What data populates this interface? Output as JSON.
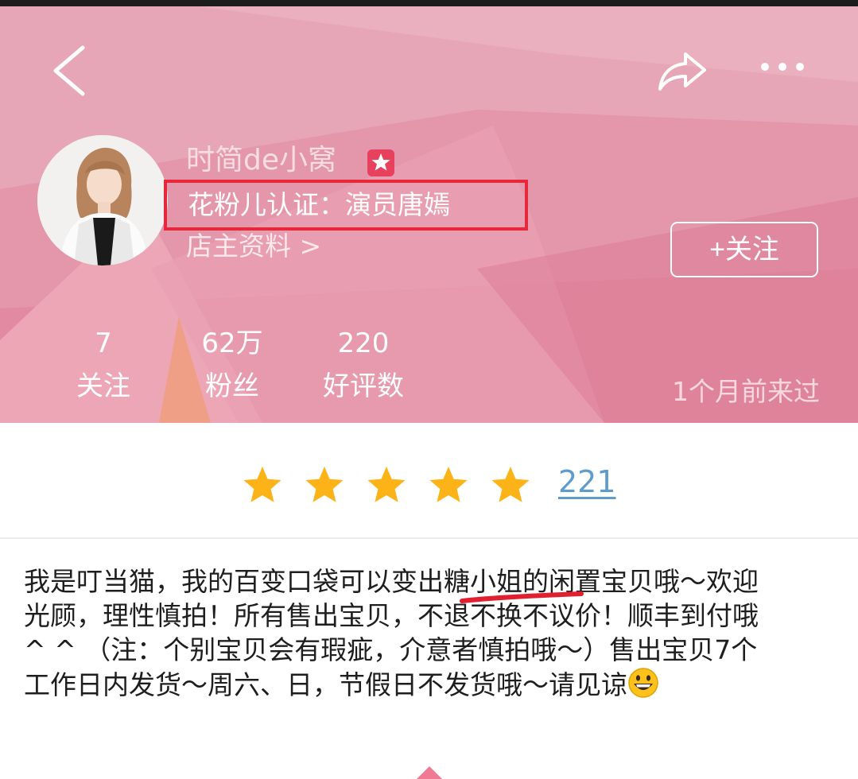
{
  "shop": {
    "name": "时简de小窝",
    "certification": "花粉儿认证：演员唐嫣",
    "owner_info_link": "店主资料 >",
    "follow_button": "+关注"
  },
  "stats": [
    {
      "value": "7",
      "label": "关注"
    },
    {
      "value": "62万",
      "label": "粉丝"
    },
    {
      "value": "220",
      "label": "好评数"
    }
  ],
  "last_visit": "1个月前来过",
  "rating": {
    "stars": 5,
    "count": "221"
  },
  "description": {
    "text": "我是叮当猫，我的百变口袋可以变出糖小姐的闲置宝贝哦～欢迎光顾，理性慎拍！所有售出宝贝，不退不换不议价！顺丰到付哦^ ^ （注：个别宝贝会有瑕疵，介意者慎拍哦～）售出宝贝7个工作日内发货～周六、日，节假日不发货哦～请见谅",
    "emoji": "grinning-face"
  },
  "colors": {
    "header_pink": "#e58fa4",
    "highlight_red": "#e6283a",
    "star_yellow": "#fbb317",
    "link_blue": "#5f9ccc",
    "badge_red": "#e8415e"
  },
  "icons": [
    "back-icon",
    "share-icon",
    "more-icon",
    "verified-star-icon",
    "star-icon",
    "grinning-face-icon",
    "up-arrow-icon"
  ]
}
